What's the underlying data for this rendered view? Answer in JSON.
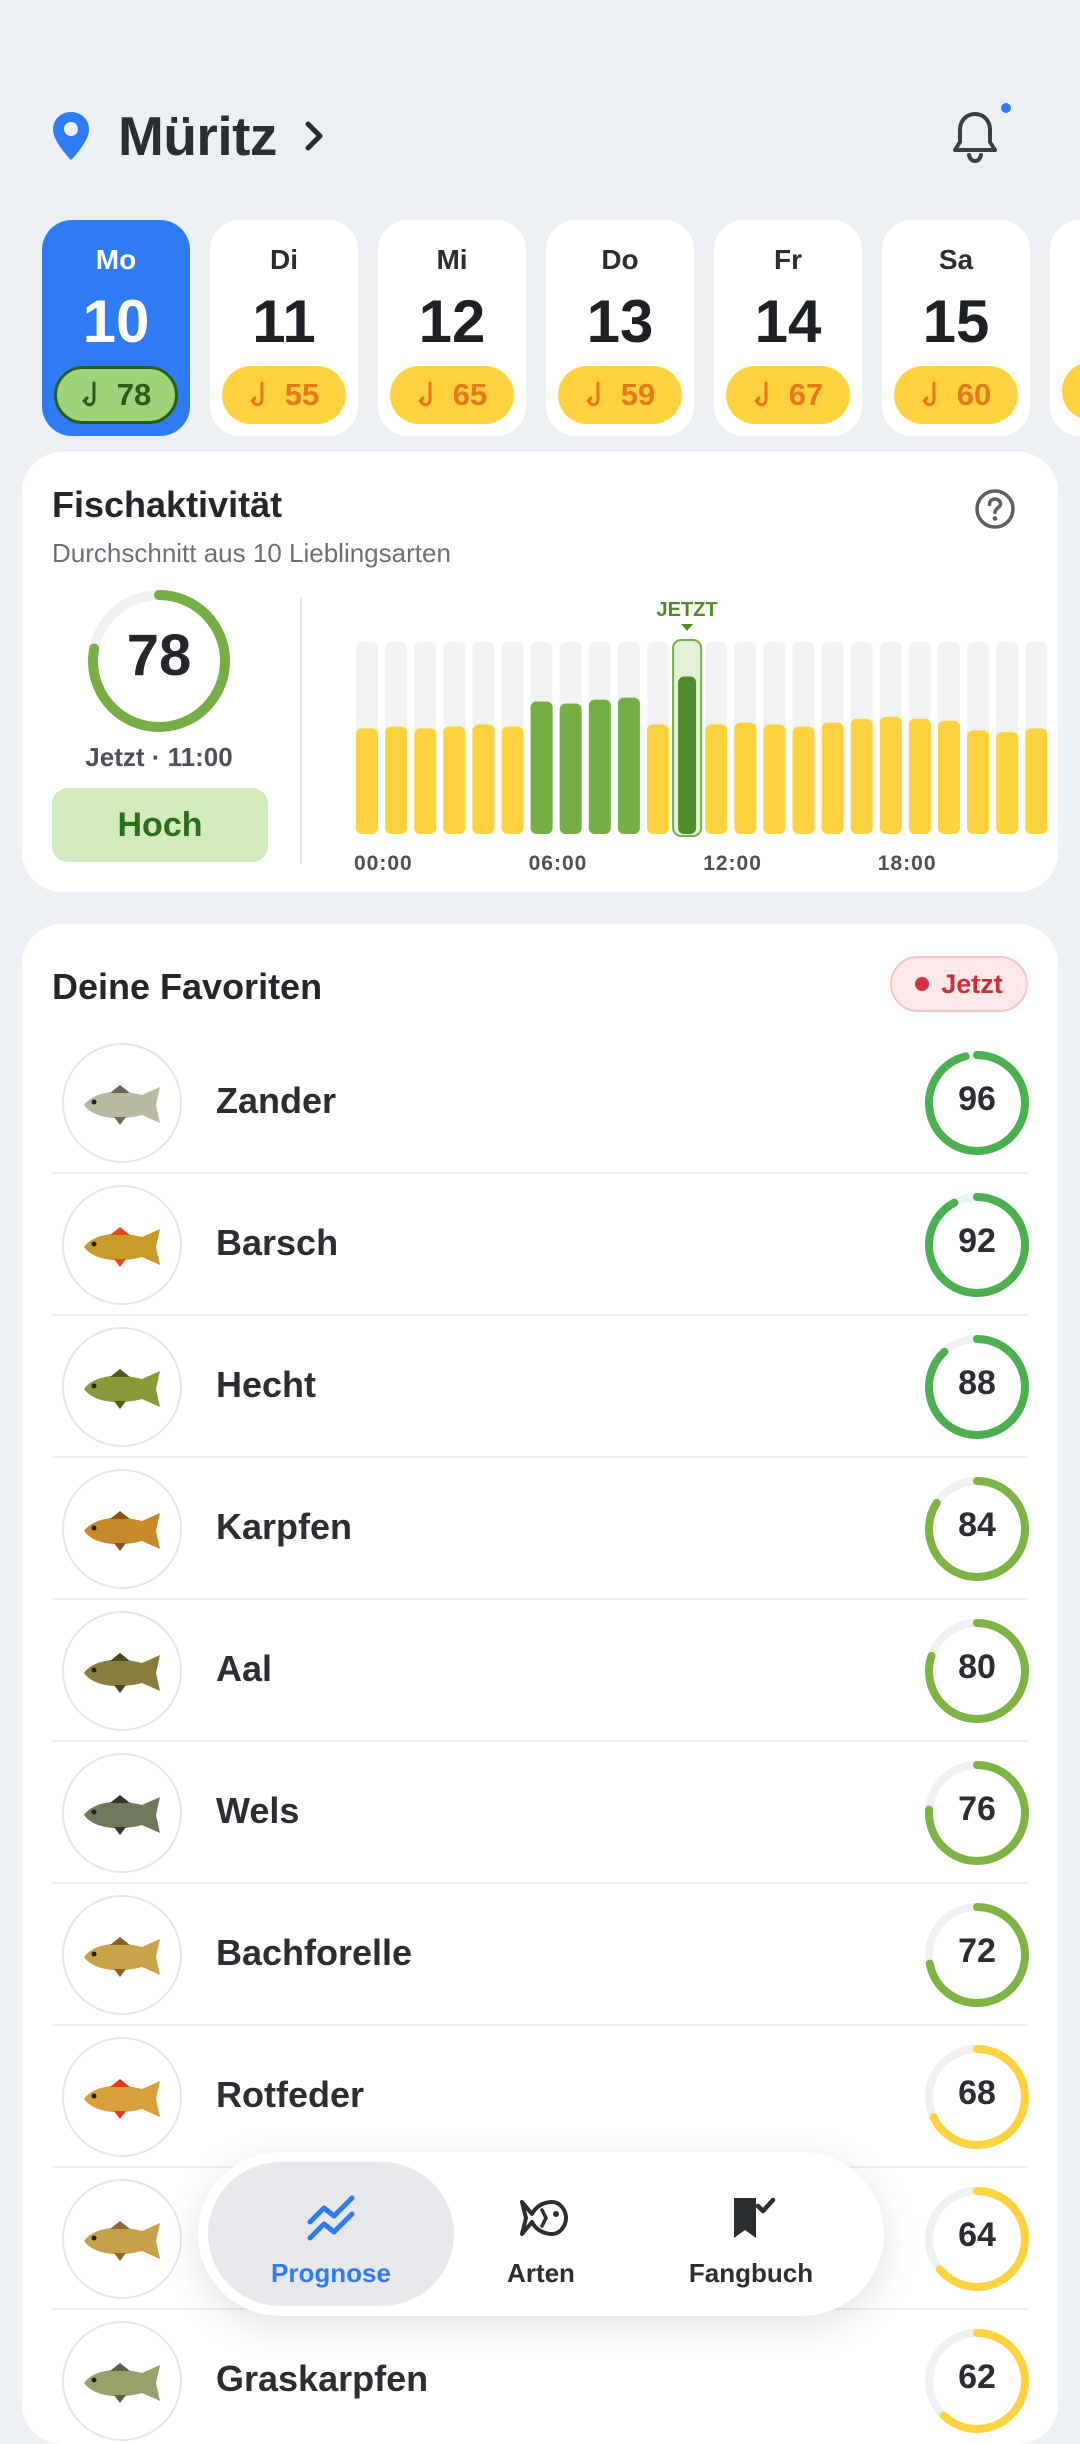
{
  "header": {
    "location": "Müritz",
    "icons": [
      "map-pin-icon",
      "chevron-right-icon",
      "bell-icon"
    ],
    "colors": {
      "accent": "#2f7bf5",
      "background": "#eceff3"
    }
  },
  "days": [
    {
      "name": "Mo",
      "num": "10",
      "score": "78",
      "active": true
    },
    {
      "name": "Di",
      "num": "11",
      "score": "55",
      "active": false
    },
    {
      "name": "Mi",
      "num": "12",
      "score": "65",
      "active": false
    },
    {
      "name": "Do",
      "num": "13",
      "score": "59",
      "active": false
    },
    {
      "name": "Fr",
      "num": "14",
      "score": "67",
      "active": false
    },
    {
      "name": "Sa",
      "num": "15",
      "score": "60",
      "active": false
    }
  ],
  "activity": {
    "title": "Fischaktivität",
    "subtitle": "Durchschnitt aus 10 Lieblingsarten",
    "score": "78",
    "score_fraction": 0.78,
    "time_label": "Jetzt · 11:00",
    "level": "Hoch",
    "now_label": "JETZT"
  },
  "chart_data": {
    "type": "bar",
    "categories": [
      "00",
      "01",
      "02",
      "03",
      "04",
      "05",
      "06",
      "07",
      "08",
      "09",
      "10",
      "11",
      "12",
      "13",
      "14",
      "15",
      "16",
      "17",
      "18",
      "19",
      "20",
      "21",
      "22",
      "23"
    ],
    "values": [
      55,
      56,
      55,
      56,
      57,
      56,
      69,
      68,
      70,
      71,
      57,
      82,
      57,
      58,
      57,
      56,
      58,
      60,
      61,
      60,
      59,
      54,
      53,
      55
    ],
    "highlight_range": [
      6,
      9
    ],
    "current_index": 11,
    "xtick_labels": [
      "00:00",
      "06:00",
      "12:00",
      "18:00"
    ],
    "ylim": [
      0,
      100
    ],
    "colors": {
      "normal": "#fdd23e",
      "high": "#76ae46",
      "current": "#4e8c2a",
      "track": "#f1f2f4"
    }
  },
  "favorites": {
    "title": "Deine Favoriten",
    "badge": "Jetzt",
    "items": [
      {
        "name": "Zander",
        "score": "96",
        "value": 96
      },
      {
        "name": "Barsch",
        "score": "92",
        "value": 92
      },
      {
        "name": "Hecht",
        "score": "88",
        "value": 88
      },
      {
        "name": "Karpfen",
        "score": "84",
        "value": 84
      },
      {
        "name": "Aal",
        "score": "80",
        "value": 80
      },
      {
        "name": "Wels",
        "score": "76",
        "value": 76
      },
      {
        "name": "Bachforelle",
        "score": "72",
        "value": 72
      },
      {
        "name": "Rotfeder",
        "score": "68",
        "value": 68
      },
      {
        "name": "",
        "score": "64",
        "value": 64
      },
      {
        "name": "Graskarpfen",
        "score": "62",
        "value": 62
      }
    ]
  },
  "nav": {
    "items": [
      {
        "label": "Prognose",
        "icon": "trend-chart-icon",
        "active": true
      },
      {
        "label": "Arten",
        "icon": "fish-icon",
        "active": false
      },
      {
        "label": "Fangbuch",
        "icon": "bookmark-check-icon",
        "active": false
      }
    ]
  }
}
